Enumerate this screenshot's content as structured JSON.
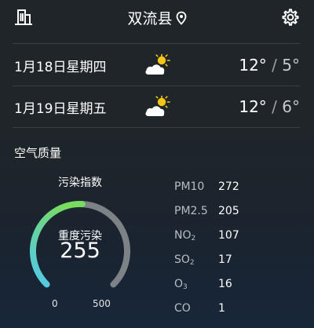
{
  "header": {
    "location": "双流县",
    "icons": {
      "city": "city-buildings-icon",
      "location": "location-pin-icon",
      "settings": "gear-icon"
    }
  },
  "forecast": [
    {
      "date": "1月18日星期四",
      "icon": "partly-cloudy-icon",
      "high": "12°",
      "sep": "/",
      "low": "5°"
    },
    {
      "date": "1月19日星期五",
      "icon": "partly-cloudy-icon",
      "high": "12°",
      "sep": "/",
      "low": "6°"
    }
  ],
  "air_quality": {
    "title": "空气质量",
    "gauge_title": "污染指数",
    "level": "重度污染",
    "value": "255",
    "scale_min": "0",
    "scale_max": "500",
    "gauge_fraction": 0.51,
    "colors": {
      "arc_start": "#52c8ee",
      "arc_end": "#78dc5e",
      "track": "#7d8287"
    },
    "pollutants": [
      {
        "name": "PM10",
        "value": "272"
      },
      {
        "name": "PM2.5",
        "value": "205"
      },
      {
        "name_main": "NO",
        "name_sub": "2",
        "value": "107"
      },
      {
        "name_main": "SO",
        "name_sub": "2",
        "value": "17"
      },
      {
        "name_main": "O",
        "name_sub": "3",
        "value": "16"
      },
      {
        "name": "CO",
        "value": "1"
      }
    ]
  }
}
